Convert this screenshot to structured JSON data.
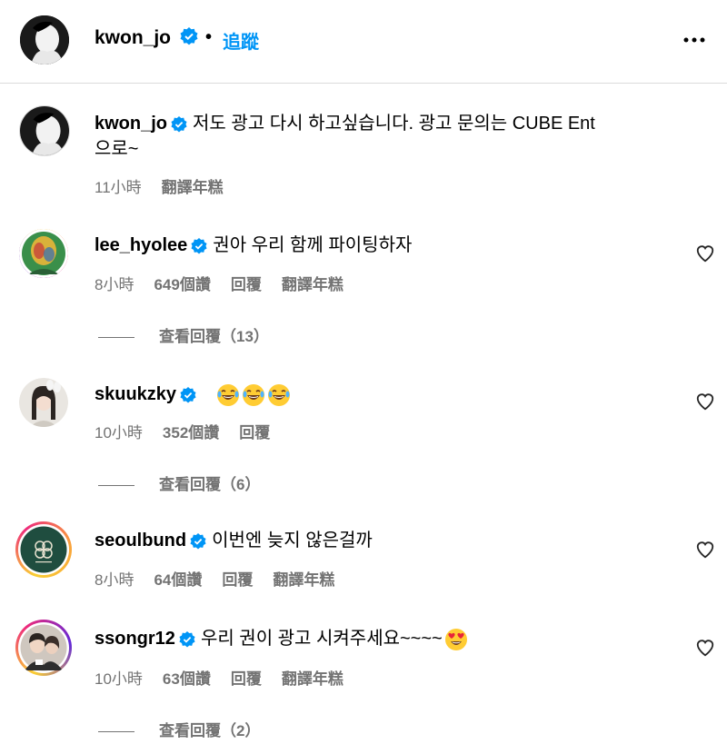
{
  "header": {
    "username": "kwon_jo",
    "separator": "•",
    "follow_label": "追蹤"
  },
  "caption": {
    "username": "kwon_jo",
    "text_line1": "저도 광고 다시 하고싶습니다. 광고 문의는 CUBE Ent",
    "text_line2": "으로~",
    "time": "11小時",
    "translate": "翻譯年糕"
  },
  "comments": [
    {
      "username": "lee_hyolee",
      "text": "권아 우리 함께 파이팅하자",
      "time": "8小時",
      "likes": "649個讚",
      "reply": "回覆",
      "translate": "翻譯年糕",
      "view_replies": "查看回覆（13）"
    },
    {
      "username": "skuukzky",
      "text": "",
      "emoji": [
        "laughing-tears-emoji",
        "laughing-tears-emoji",
        "laughing-tears-emoji"
      ],
      "time": "10小時",
      "likes": "352個讚",
      "reply": "回覆",
      "view_replies": "查看回覆（6）"
    },
    {
      "username": "seoulbund",
      "text": "이번엔 늦지 않은걸까",
      "time": "8小時",
      "likes": "64個讚",
      "reply": "回覆",
      "translate": "翻譯年糕"
    },
    {
      "username": "ssongr12",
      "text": "우리 권이 광고 시켜주세요~~~~",
      "emoji": [
        "heart-eyes-emoji"
      ],
      "time": "10小時",
      "likes": "63個讚",
      "reply": "回覆",
      "translate": "翻譯年糕",
      "view_replies": "查看回覆（2）"
    }
  ],
  "colors": {
    "link_blue": "#0095f6",
    "verified_blue": "#0095f6",
    "meta_gray": "#737373",
    "divider": "#dbdbdb",
    "story_ring_start": "#f9ce34",
    "story_ring_end": "#ee2a7b"
  }
}
